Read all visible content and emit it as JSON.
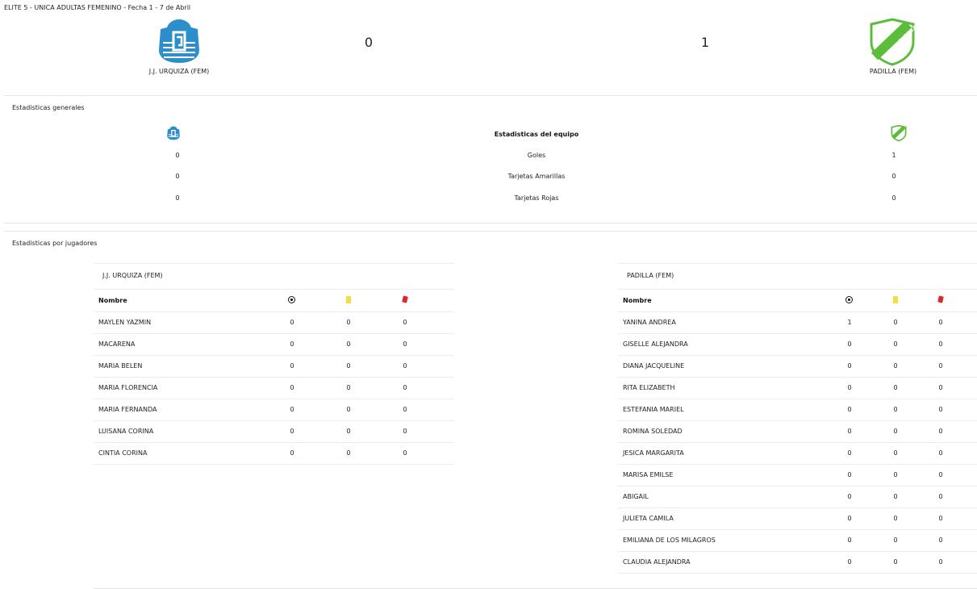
{
  "match": {
    "title": "ELITE 5 - UNICA ADULTAS FEMENINO - Fecha 1 - 7 de Abril",
    "home": {
      "name": "J.J. URQUIZA (FEM)",
      "score": "0",
      "crest_color": "#2d8fc9",
      "crest_icon": "jj-urquiza-crest-icon"
    },
    "away": {
      "name": "PADILLA (FEM)",
      "score": "1",
      "crest_color": "#5cbd3a",
      "crest_icon": "padilla-crest-icon"
    }
  },
  "general_stats": {
    "section_label": "Estadisticas generales",
    "header": "Estadisticas del equipo",
    "rows": [
      {
        "label": "Goles",
        "home": "0",
        "away": "1"
      },
      {
        "label": "Tarjetas Amarillas",
        "home": "0",
        "away": "0"
      },
      {
        "label": "Tarjetas Rojas",
        "home": "0",
        "away": "0"
      }
    ]
  },
  "player_stats": {
    "section_label": "Estadisticas por jugadores",
    "column_name": "Nombre",
    "column_icons": [
      "goal-ball-icon",
      "yellow-card-icon",
      "red-card-icon"
    ],
    "home": {
      "team": "J.J. URQUIZA (FEM)",
      "players": [
        {
          "name": "MAYLEN YAZMIN",
          "goals": "0",
          "yellow": "0",
          "red": "0"
        },
        {
          "name": "MACARENA",
          "goals": "0",
          "yellow": "0",
          "red": "0"
        },
        {
          "name": "MARIA BELEN",
          "goals": "0",
          "yellow": "0",
          "red": "0"
        },
        {
          "name": "MARIA FLORENCIA",
          "goals": "0",
          "yellow": "0",
          "red": "0"
        },
        {
          "name": "MARIA FERNANDA",
          "goals": "0",
          "yellow": "0",
          "red": "0"
        },
        {
          "name": "LUISANA CORINA",
          "goals": "0",
          "yellow": "0",
          "red": "0"
        },
        {
          "name": "CINTIA CORINA",
          "goals": "0",
          "yellow": "0",
          "red": "0"
        }
      ]
    },
    "away": {
      "team": "PADILLA (FEM)",
      "players": [
        {
          "name": "YANINA ANDREA",
          "goals": "1",
          "yellow": "0",
          "red": "0"
        },
        {
          "name": "GISELLE ALEJANDRA",
          "goals": "0",
          "yellow": "0",
          "red": "0"
        },
        {
          "name": "DIANA JACQUELINE",
          "goals": "0",
          "yellow": "0",
          "red": "0"
        },
        {
          "name": "RITA ELIZABETH",
          "goals": "0",
          "yellow": "0",
          "red": "0"
        },
        {
          "name": "ESTEFANIA MARIEL",
          "goals": "0",
          "yellow": "0",
          "red": "0"
        },
        {
          "name": "ROMINA SOLEDAD",
          "goals": "0",
          "yellow": "0",
          "red": "0"
        },
        {
          "name": "JESICA MARGARITA",
          "goals": "0",
          "yellow": "0",
          "red": "0"
        },
        {
          "name": "MARISA EMILSE",
          "goals": "0",
          "yellow": "0",
          "red": "0"
        },
        {
          "name": "ABIGAIL",
          "goals": "0",
          "yellow": "0",
          "red": "0"
        },
        {
          "name": "JULIETA CAMILA",
          "goals": "0",
          "yellow": "0",
          "red": "0"
        },
        {
          "name": "EMILIANA DE LOS MILAGROS",
          "goals": "0",
          "yellow": "0",
          "red": "0"
        },
        {
          "name": "CLAUDIA ALEJANDRA",
          "goals": "0",
          "yellow": "0",
          "red": "0"
        }
      ]
    }
  }
}
